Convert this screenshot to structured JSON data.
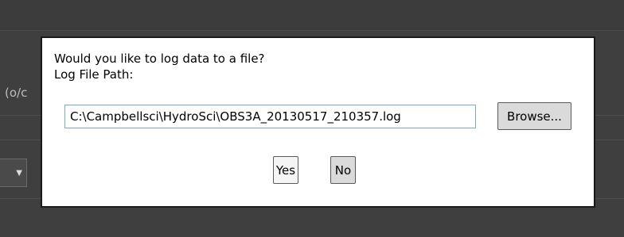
{
  "background": {
    "partial_label": "(o/c"
  },
  "dialog": {
    "prompt": "Would you like to log data to a file?",
    "path_label": "Log File Path:",
    "path_value": "C:\\Campbellsci\\HydroSci\\OBS3A_20130517_210357.log",
    "browse_label": "Browse...",
    "yes_label": "Yes",
    "no_label": "No"
  },
  "colors": {
    "backdrop": "#3f3f3f",
    "dialog_bg": "#ffffff",
    "input_border": "#7aa7d6",
    "button_bg": "#dadada"
  }
}
